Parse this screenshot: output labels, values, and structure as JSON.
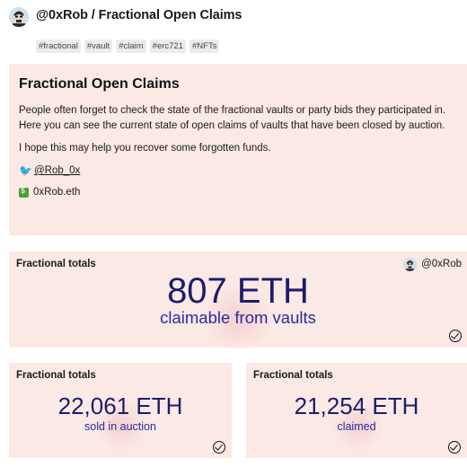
{
  "header": {
    "title": "@0xRob / Fractional Open Claims",
    "tags": [
      "#fractional",
      "#vault",
      "#claim",
      "#erc721",
      "#NFTs"
    ]
  },
  "intro": {
    "title": "Fractional Open Claims",
    "paragraph_1_line_1": "People often forget to check the state of the fractional vaults or party bids they participated in.",
    "paragraph_1_line_2": "Here you can see the current state of open claims of vaults that have been closed by auction.",
    "paragraph_2": "I hope this may help you recover some forgotten funds.",
    "twitter_handle": "@Rob_0x",
    "ens_name": "0xRob.eth"
  },
  "counters": [
    {
      "title": "Fractional totals",
      "author": "@0xRob",
      "value": "807 ETH",
      "caption": "claimable from vaults"
    },
    {
      "title": "Fractional totals",
      "value": "22,061 ETH",
      "caption": "sold in auction"
    },
    {
      "title": "Fractional totals",
      "value": "21,254 ETH",
      "caption": "claimed"
    }
  ],
  "colors": {
    "card_background": "#fbe9e6",
    "counter_value": "#1c1c6b",
    "counter_caption": "#2a2aa0"
  },
  "icons": {
    "avatar": "avatar-icon",
    "twitter": "bird-icon",
    "money": "money-icon",
    "status": "check-circle-icon"
  }
}
